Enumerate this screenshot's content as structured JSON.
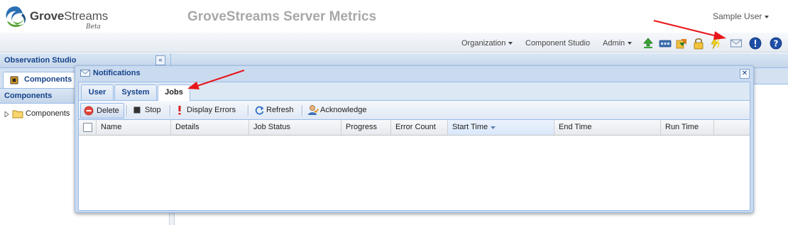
{
  "brand": {
    "logo_bold": "Grove",
    "logo_regular": "Streams",
    "logo_tag": "Beta"
  },
  "header": {
    "title": "GroveStreams Server Metrics",
    "user_menu": "Sample User"
  },
  "menubar": {
    "items": [
      "Organization",
      "Component Studio",
      "Admin"
    ],
    "icons": [
      "upload-icon",
      "dashboard-icon",
      "import-icon",
      "lock-icon",
      "lightning-icon",
      "notifications-envelope-icon",
      "alert-icon",
      "help-icon"
    ]
  },
  "left_panel": {
    "title": "Observation Studio",
    "tab_label": "Components",
    "section_title": "Components",
    "tree": [
      {
        "label": "Components",
        "expanded": false
      }
    ]
  },
  "notifications": {
    "title": "Notifications",
    "tabs": [
      {
        "label": "User",
        "active": false
      },
      {
        "label": "System",
        "active": false
      },
      {
        "label": "Jobs",
        "active": true
      }
    ],
    "toolbar": {
      "delete": "Delete",
      "stop": "Stop",
      "display_errors": "Display Errors",
      "refresh": "Refresh",
      "acknowledge": "Acknowledge"
    },
    "columns": [
      "Name",
      "Details",
      "Job Status",
      "Progress",
      "Error Count",
      "Start Time",
      "End Time",
      "Run Time"
    ],
    "sorted_column": "Start Time",
    "sort_direction": "descending",
    "rows": []
  },
  "colors": {
    "panel_header_text": "#15428b",
    "panel_border": "#99bbe8",
    "annotation_arrow": "#e8151a",
    "title_gray": "#a8a8a8"
  }
}
